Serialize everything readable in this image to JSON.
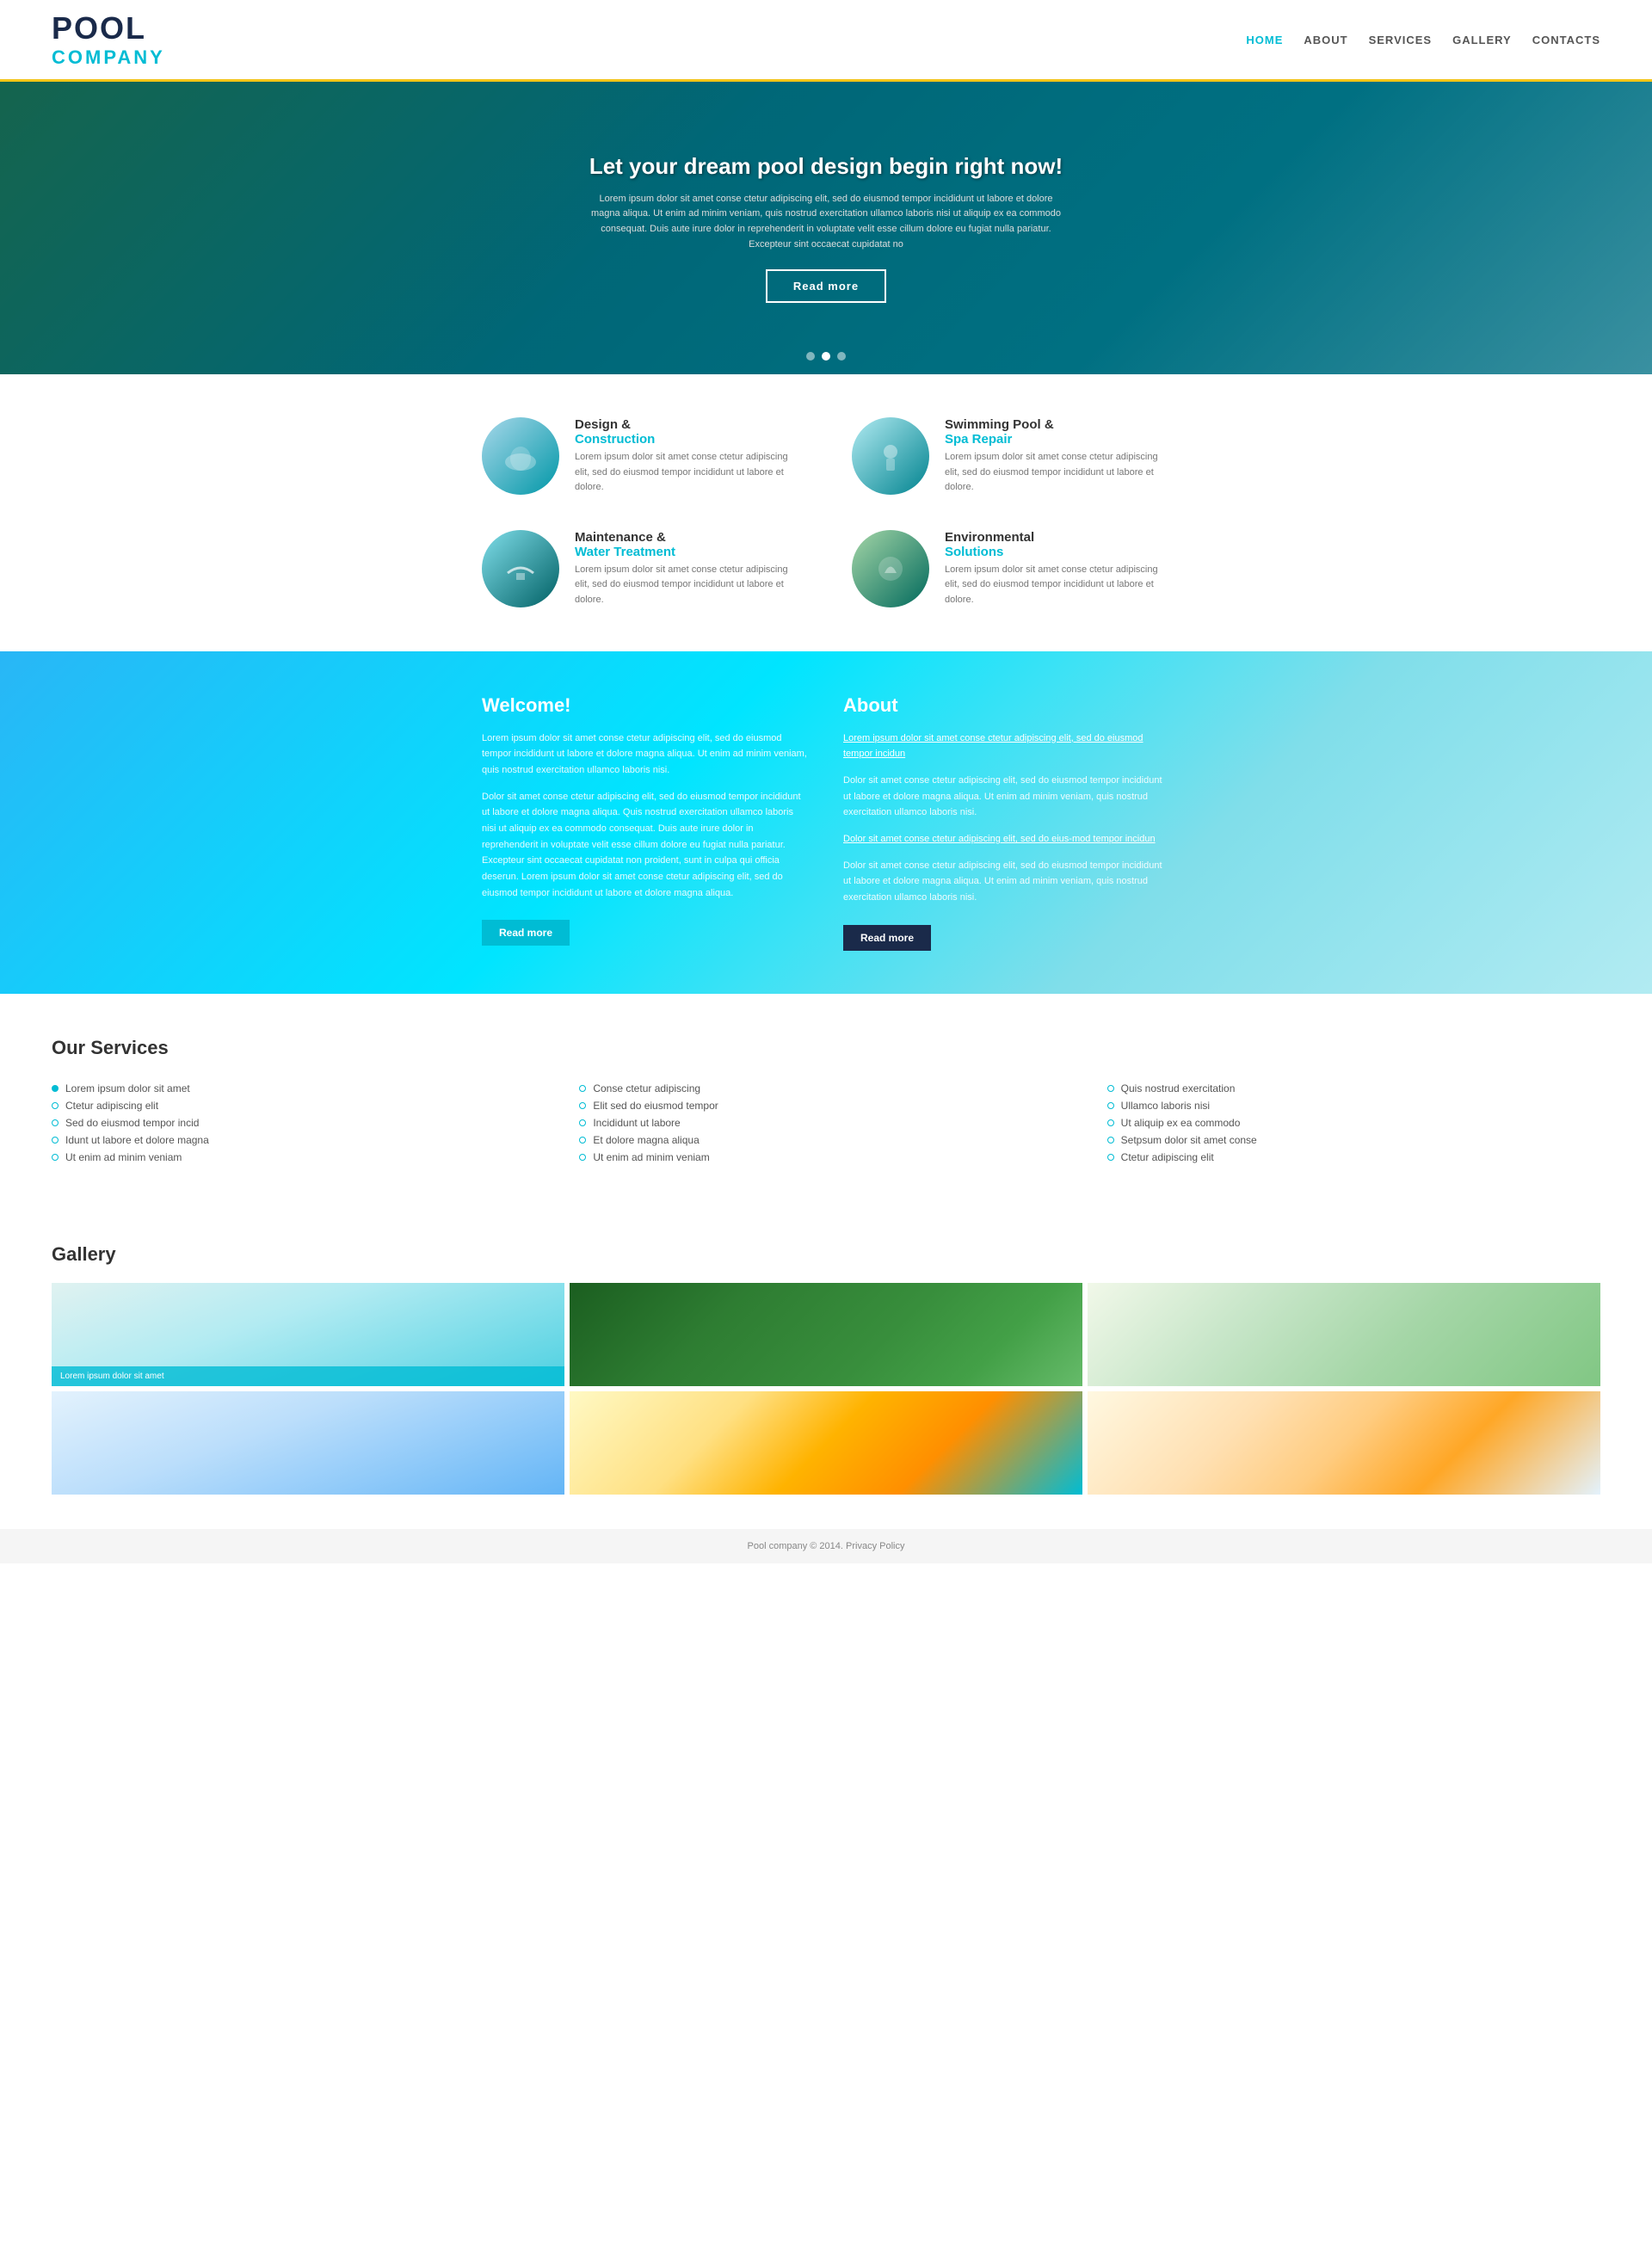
{
  "header": {
    "logo_pool": "POOL",
    "logo_company": "COMPANY",
    "nav": [
      {
        "label": "HOME",
        "active": true
      },
      {
        "label": "ABOUT",
        "active": false
      },
      {
        "label": "SERVICES",
        "active": false
      },
      {
        "label": "GALLERY",
        "active": false
      },
      {
        "label": "CONTACTS",
        "active": false
      }
    ]
  },
  "hero": {
    "title": "Let your dream pool design begin right now!",
    "text": "Lorem ipsum dolor sit amet conse ctetur adipiscing elit, sed do eiusmod tempor incididunt ut labore et dolore magna aliqua. Ut enim ad minim veniam, quis nostrud exercitation ullamco laboris nisi ut aliquip ex ea commodo consequat. Duis aute irure dolor in reprehenderit in voluptate velit esse cillum dolore eu fugiat nulla pariatur. Excepteur sint occaecat cupidatat no",
    "btn_label": "Read more",
    "dots": [
      1,
      2,
      3
    ],
    "active_dot": 2
  },
  "services": {
    "items": [
      {
        "title": "Design &",
        "accent": "Construction",
        "text": "Lorem ipsum dolor sit amet conse ctetur adipiscing elit, sed do eiusmod tempor incididunt ut labore et dolore.",
        "color": "blue"
      },
      {
        "title": "Swimming Pool &",
        "accent": "Spa Repair",
        "text": "Lorem ipsum dolor sit amet conse ctetur adipiscing elit, sed do eiusmod tempor incididunt ut labore et dolore.",
        "color": "teal"
      },
      {
        "title": "Maintenance &",
        "accent": "Water Treatment",
        "text": "Lorem ipsum dolor sit amet conse ctetur adipiscing elit, sed do eiusmod tempor incididunt ut labore et dolore.",
        "color": "teal"
      },
      {
        "title": "Environmental",
        "accent": "Solutions",
        "text": "Lorem ipsum dolor sit amet conse ctetur adipiscing elit, sed do eiusmod tempor incididunt ut labore et dolore.",
        "color": "green"
      }
    ]
  },
  "welcome": {
    "title": "Welcome!",
    "text1": "Lorem ipsum dolor sit amet conse ctetur adipiscing elit, sed do eiusmod tempor incididunt ut labore et dolore magna aliqua. Ut enim ad minim veniam, quis nostrud exercitation ullamco laboris nisi.",
    "text2": "Dolor sit amet conse ctetur adipiscing elit, sed do eiusmod tempor incididunt ut labore et dolore magna aliqua. Quis nostrud exercitation ullamco laboris nisi ut aliquip ex ea commodo consequat. Duis aute irure dolor in reprehenderit in voluptate velit esse cillum dolore eu fugiat nulla pariatur. Excepteur sint occaecat cupidatat non proident, sunt in culpa qui officia deserun. Lorem ipsum dolor sit amet conse ctetur adipiscing elit, sed do eiusmod tempor incididunt ut labore et dolore magna aliqua.",
    "btn_label": "Read more"
  },
  "about": {
    "title": "About",
    "link1": "Lorem ipsum dolor sit amet conse ctetur adipiscing elit, sed do eiusmod tempor incidun",
    "text1": "Dolor sit amet conse ctetur adipiscing elit, sed do eiusmod tempor incididunt ut labore et dolore magna aliqua. Ut enim ad minim veniam, quis nostrud exercitation ullamco laboris nisi.",
    "link2": "Dolor sit amet conse ctetur adipiscing elit, sed do eius-mod tempor incidun",
    "text2": "Dolor sit amet conse ctetur adipiscing elit, sed do eiusmod tempor incididunt ut labore et dolore magna aliqua. Ut enim ad minim veniam, quis nostrud exercitation ullamco laboris nisi.",
    "btn_label": "Read more"
  },
  "our_services": {
    "title": "Our Services",
    "col1": [
      {
        "label": "Lorem ipsum dolor sit amet",
        "filled": true
      },
      {
        "label": "Ctetur adipiscing elit",
        "filled": false
      },
      {
        "label": "Sed do eiusmod tempor incid",
        "filled": false
      },
      {
        "label": "Idunt ut labore et dolore magna",
        "filled": false
      },
      {
        "label": "Ut enim ad minim veniam",
        "filled": false
      }
    ],
    "col2": [
      {
        "label": "Conse ctetur adipiscing",
        "filled": false
      },
      {
        "label": "Elit sed do eiusmod tempor",
        "filled": false
      },
      {
        "label": "Incididunt ut labore",
        "filled": false
      },
      {
        "label": "Et dolore magna aliqua",
        "filled": false
      },
      {
        "label": "Ut enim ad minim veniam",
        "filled": false
      }
    ],
    "col3": [
      {
        "label": "Quis nostrud exercitation",
        "filled": false
      },
      {
        "label": "Ullamco laboris nisi",
        "filled": false
      },
      {
        "label": "Ut aliquip ex ea commodo",
        "filled": false
      },
      {
        "label": "Setpsum dolor sit amet conse",
        "filled": false
      },
      {
        "label": "Ctetur adipiscing elit",
        "filled": false
      }
    ]
  },
  "gallery": {
    "title": "Gallery",
    "items": [
      {
        "caption": "Lorem ipsum dolor sit amet",
        "show_caption": true,
        "color": "pool-1"
      },
      {
        "caption": "",
        "show_caption": false,
        "color": "pool-2"
      },
      {
        "caption": "",
        "show_caption": false,
        "color": "pool-3"
      },
      {
        "caption": "",
        "show_caption": false,
        "color": "pool-4"
      },
      {
        "caption": "",
        "show_caption": false,
        "color": "pool-5"
      },
      {
        "caption": "",
        "show_caption": false,
        "color": "pool-6"
      }
    ]
  },
  "footer": {
    "text": "Pool company © 2014.",
    "link": "Privacy Policy"
  }
}
